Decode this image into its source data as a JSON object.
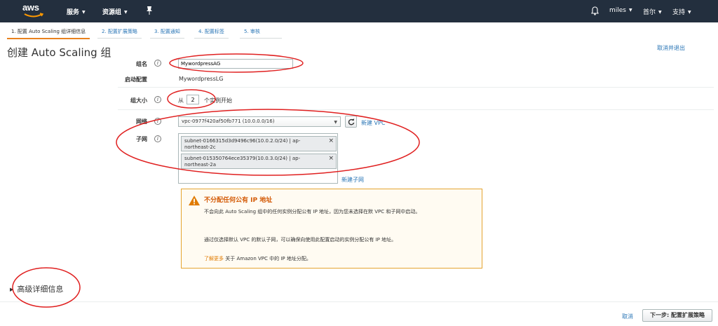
{
  "topnav": {
    "logo_text": "aws",
    "services": "服务",
    "resource_groups": "资源组",
    "user": "miles",
    "region": "首尔",
    "support": "支持"
  },
  "steps": [
    {
      "label": "1. 配置 Auto Scaling 组详细信息",
      "active": true
    },
    {
      "label": "2. 配置扩展策略"
    },
    {
      "label": "3. 配置通知"
    },
    {
      "label": "4. 配置标签"
    },
    {
      "label": "5. 审核"
    }
  ],
  "page": {
    "title": "创建 Auto Scaling 组",
    "cancel_exit": "取消并退出"
  },
  "form": {
    "group_name_label": "组名",
    "group_name_value": "MywordpressAG",
    "launch_config_label": "启动配置",
    "launch_config_value": "MywordpressLG",
    "group_size_label": "组大小",
    "group_size_prefix": "从",
    "group_size_value": "2",
    "group_size_suffix": "个实例开始",
    "network_label": "网络",
    "network_value": "vpc-0977f420af50fb771 (10.0.0.0/16)",
    "new_vpc": "新建 VPC",
    "subnet_label": "子网",
    "subnets": [
      {
        "line1": "subnet-0166315d3d9496c96(10.0.2.0/24) | ap-",
        "line2": "northeast-2c"
      },
      {
        "line1": "subnet-015350764ece35379(10.0.3.0/24) | ap-",
        "line2": "northeast-2a"
      }
    ],
    "new_subnet": "新建子网"
  },
  "warning": {
    "title": "不分配任何公有 IP 地址",
    "p1": "不会向此 Auto Scaling 组中的任何实例分配公有 IP 地址，因为您未选择在默 VPC 和子网中启动。",
    "p2": "通过仅选择默认 VPC 的默认子网，可以确保向使用此配置启动的实例分配公有 IP 地址。",
    "link": "了解更多",
    "p3": "关于 Amazon VPC 中的 IP 地址分配。"
  },
  "advanced": "高级详细信息",
  "footer": {
    "cancel": "取消",
    "next": "下一步: 配置扩展策略"
  },
  "colors": {
    "nav_bg": "#232f3e",
    "link": "#2a76b6",
    "warning_title": "#d45b07",
    "annotation": "#e02020"
  }
}
